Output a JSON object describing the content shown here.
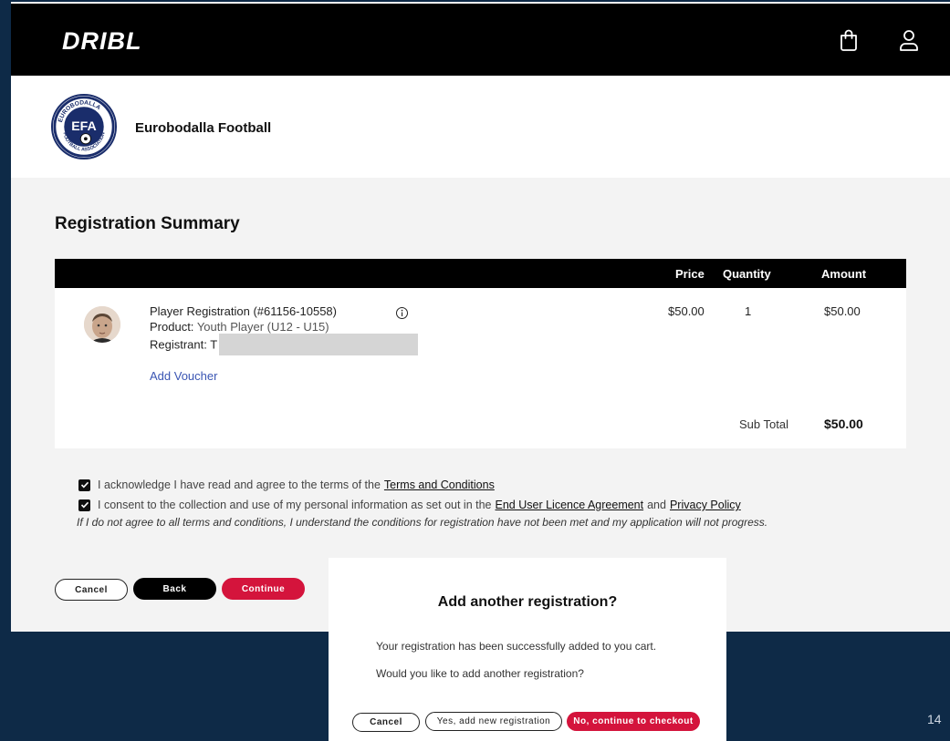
{
  "header": {
    "brand": "DRIBL",
    "icons": [
      "shopping-bag-icon",
      "user-icon"
    ]
  },
  "org": {
    "name": "Eurobodalla Football",
    "logo_text_top": "EUROBODALLA",
    "logo_text_center": "EFA",
    "logo_text_bottom": "FOOTBALL ASSOCIATION"
  },
  "page": {
    "title": "Registration Summary"
  },
  "table": {
    "headers": {
      "price": "Price",
      "quantity": "Quantity",
      "amount": "Amount"
    },
    "item": {
      "title": "Player Registration (#61156-10558)",
      "product_label": "Product:",
      "product_value": "Youth Player (U12 - U15)",
      "registrant_label": "Registrant:",
      "registrant_value": "T",
      "price": "$50.00",
      "quantity": "1",
      "amount": "$50.00"
    },
    "add_voucher": "Add Voucher",
    "subtotal_label": "Sub Total",
    "subtotal_value": "$50.00"
  },
  "terms": {
    "line1_prefix": "I acknowledge I have read and agree to the terms of the",
    "line1_link": "Terms and Conditions",
    "line2_prefix": "I consent to the collection and use of my personal information as set out in the",
    "line2_link1": "End User Licence Agreement",
    "line2_and": "and",
    "line2_link2": "Privacy Policy",
    "disclaimer": "If I do not agree to all terms and conditions, I understand the conditions for registration have not been met and my application will not progress.",
    "checked": [
      true,
      true
    ]
  },
  "actions": {
    "cancel": "Cancel",
    "back": "Back",
    "continue": "Continue"
  },
  "modal": {
    "title": "Add another registration?",
    "line1": "Your registration has been successfully added to you cart.",
    "line2": "Would you like to add another registration?",
    "cancel": "Cancel",
    "add_new": "Yes, add new registration",
    "checkout": "No, continue to checkout"
  },
  "slide_number": "14",
  "colors": {
    "background": "#0e2a47",
    "accent_red": "#d4143c",
    "link_blue": "#3a55b3"
  }
}
